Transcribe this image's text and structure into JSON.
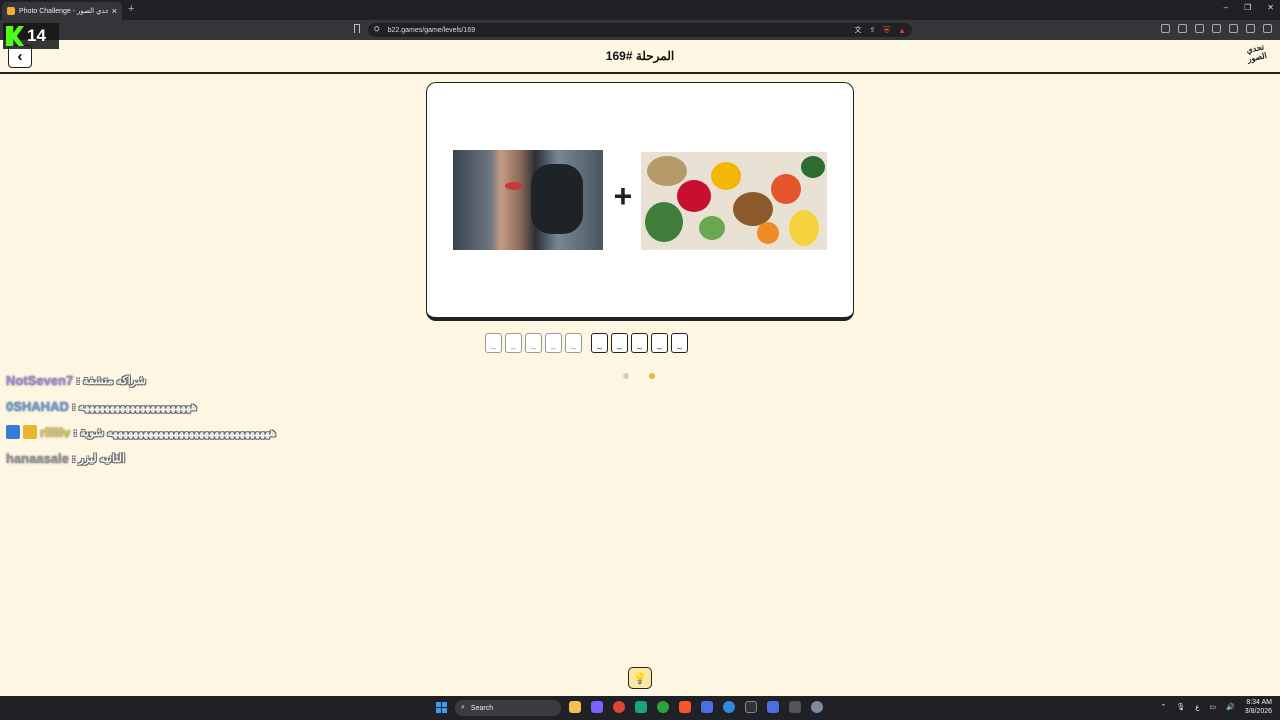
{
  "browser": {
    "tab_title": "Photo Challenge - تحدي الصور",
    "close_tab": "×",
    "new_tab": "+",
    "url": "b22.games/game/levels/169",
    "win_minimize": "–",
    "win_restore": "❐",
    "win_close": "✕"
  },
  "overlay": {
    "kick_viewers": "14"
  },
  "header": {
    "back_symbol": "‹",
    "level_title": "المرحلة #169",
    "logo_text": "تحدي الصور"
  },
  "puzzle": {
    "plus": "+",
    "slot_char": "_",
    "group1_count": 5,
    "group2_count": 5,
    "dot_colors": [
      "#cfcfcf",
      "#f0b347"
    ]
  },
  "chat": [
    {
      "user": "NotSeven7",
      "user_color": "#a98ae0",
      "text": ": شراكه متشفة",
      "badges": []
    },
    {
      "user": "0SHAHAD",
      "user_color": "#6aa3e0",
      "text": ": ههههههههههههههههههههههه",
      "badges": []
    },
    {
      "user": "rlllllv",
      "user_color": "#d9c84a",
      "text": ": ههههههههههههههههههههههههههههههههه شوية",
      "badges": [
        "#3a7bd5",
        "#e7b72b"
      ]
    },
    {
      "user": "hanaasale",
      "user_color": "#9a9a9a",
      "text": ": الثانيه ليزر",
      "badges": []
    }
  ],
  "hint": {
    "icon": "💡"
  },
  "taskbar": {
    "search_label": "Search",
    "time": "8:34 AM",
    "date": "3/8/2026",
    "lang": "ع"
  }
}
